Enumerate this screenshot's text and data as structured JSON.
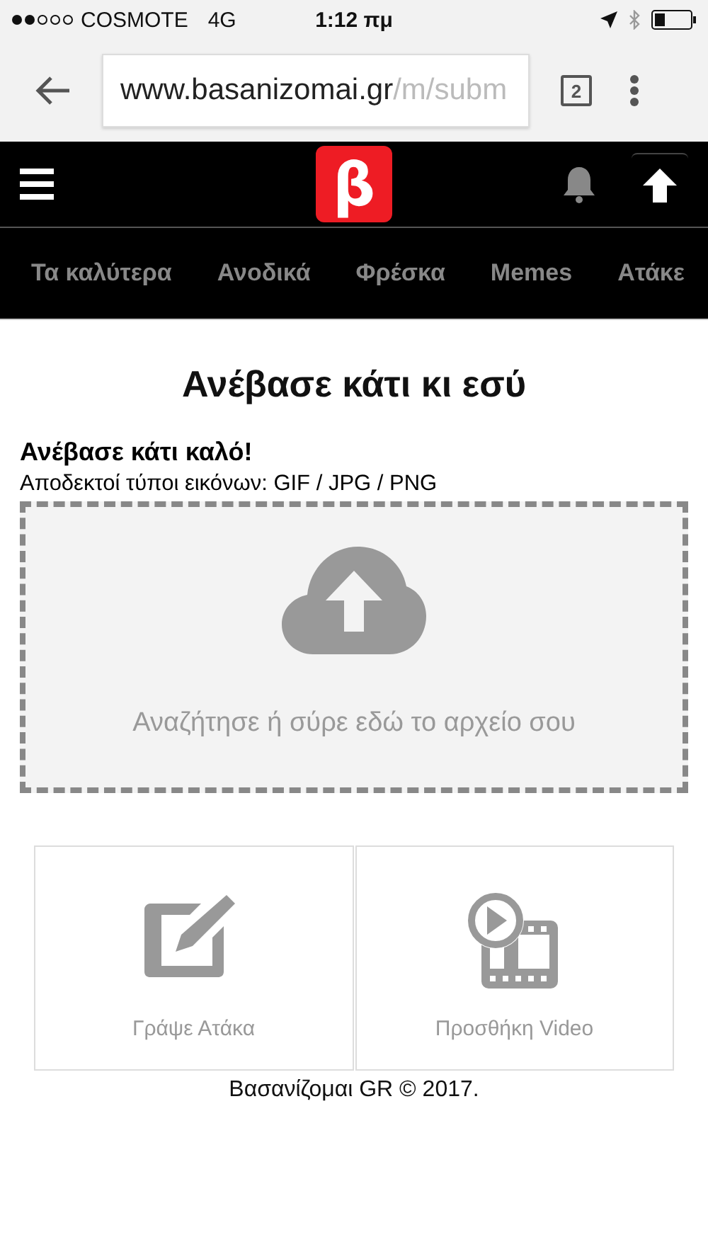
{
  "status_bar": {
    "carrier": "COSMOTE",
    "network": "4G",
    "time": "1:12 πμ"
  },
  "browser": {
    "url_host": "www.basanizomai.gr",
    "url_path": "/m/subm",
    "tab_count": "2"
  },
  "header": {
    "logo": "β"
  },
  "nav": [
    {
      "label": "Τα καλύτερα"
    },
    {
      "label": "Ανοδικά"
    },
    {
      "label": "Φρέσκα"
    },
    {
      "label": "Memes"
    },
    {
      "label": "Ατάκε"
    }
  ],
  "page": {
    "title": "Ανέβασε κάτι κι εσύ",
    "subtitle": "Ανέβασε κάτι καλό!",
    "accepted_types": "Αποδεκτοί τύποι εικόνων: GIF / JPG / PNG",
    "dropzone_text": "Αναζήτησε ή σύρε εδώ το αρχείο σου"
  },
  "options": [
    {
      "kind": "write",
      "label": "Γράψε Ατάκα"
    },
    {
      "kind": "video",
      "label": "Προσθήκη Video"
    }
  ],
  "footer": "Βασανίζομαι GR © 2017."
}
